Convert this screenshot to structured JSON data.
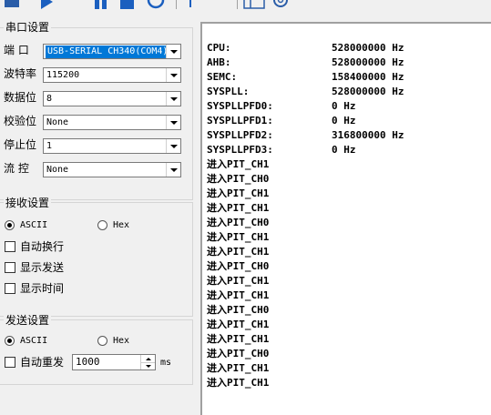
{
  "toolbar": {
    "icons": [
      "open-icon",
      "play-icon",
      "pause-icon",
      "stop-icon",
      "refresh-icon",
      "pin-icon",
      "window-icon",
      "gear-icon"
    ]
  },
  "serial": {
    "title": "串口设置",
    "port": {
      "label": "端  口",
      "value": "USB-SERIAL CH340(COM4)"
    },
    "baud": {
      "label": "波特率",
      "value": "115200"
    },
    "databits": {
      "label": "数据位",
      "value": "8"
    },
    "parity": {
      "label": "校验位",
      "value": "None"
    },
    "stopbits": {
      "label": "停止位",
      "value": "1"
    },
    "flow": {
      "label": "流  控",
      "value": "None"
    }
  },
  "receive": {
    "title": "接收设置",
    "ascii": "ASCII",
    "hex": "Hex",
    "mode": "ASCII",
    "auto_wrap": "自动换行",
    "show_send": "显示发送",
    "show_time": "显示时间"
  },
  "send": {
    "title": "发送设置",
    "ascii": "ASCII",
    "hex": "Hex",
    "mode": "ASCII",
    "auto_resend": "自动重发",
    "interval": "1000",
    "unit": "ms"
  },
  "terminal": {
    "kv": [
      {
        "k": "CPU:",
        "v": "528000000 Hz"
      },
      {
        "k": "AHB:",
        "v": "528000000 Hz"
      },
      {
        "k": "SEMC:",
        "v": "158400000 Hz"
      },
      {
        "k": "SYSPLL:",
        "v": "528000000 Hz"
      },
      {
        "k": "SYSPLLPFD0:",
        "v": "0 Hz"
      },
      {
        "k": "SYSPLLPFD1:",
        "v": "0 Hz"
      },
      {
        "k": "SYSPLLPFD2:",
        "v": "316800000 Hz"
      },
      {
        "k": "SYSPLLPFD3:",
        "v": "0 Hz"
      }
    ],
    "lines": [
      "进入PIT_CH1",
      "进入PIT_CH0",
      "进入PIT_CH1",
      "进入PIT_CH1",
      "进入PIT_CH0",
      "进入PIT_CH1",
      "进入PIT_CH1",
      "进入PIT_CH0",
      "进入PIT_CH1",
      "进入PIT_CH1",
      "进入PIT_CH0",
      "进入PIT_CH1",
      "进入PIT_CH1",
      "进入PIT_CH0",
      "进入PIT_CH1",
      "进入PIT_CH1"
    ]
  }
}
